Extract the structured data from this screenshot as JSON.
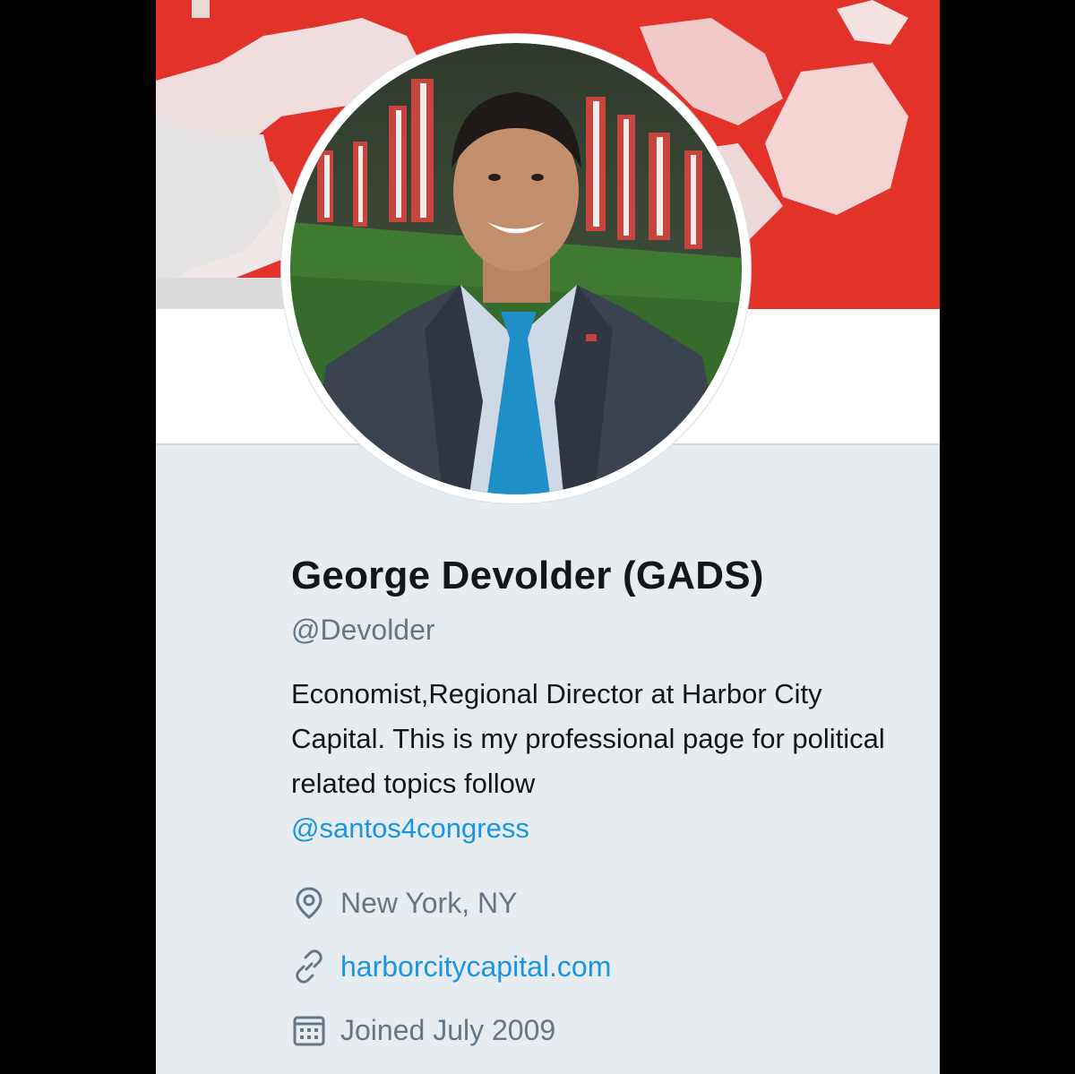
{
  "profile": {
    "display_name": "George Devolder (GADS)",
    "handle": "@Devolder",
    "bio_text": "Economist,Regional Director at Harbor City Capital. This is my professional page for political related topics follow",
    "bio_mention": "@santos4congress",
    "location": "New York, NY",
    "website": "harborcitycapital.com",
    "joined": "Joined July 2009"
  },
  "icons": {
    "location": "location-pin-icon",
    "website": "link-icon",
    "joined": "calendar-icon"
  },
  "colors": {
    "banner_red": "#e3322a",
    "link_blue": "#1b95e0",
    "secondary_text": "#657786",
    "primary_text": "#14171a",
    "page_background": "#e6ecf0"
  }
}
